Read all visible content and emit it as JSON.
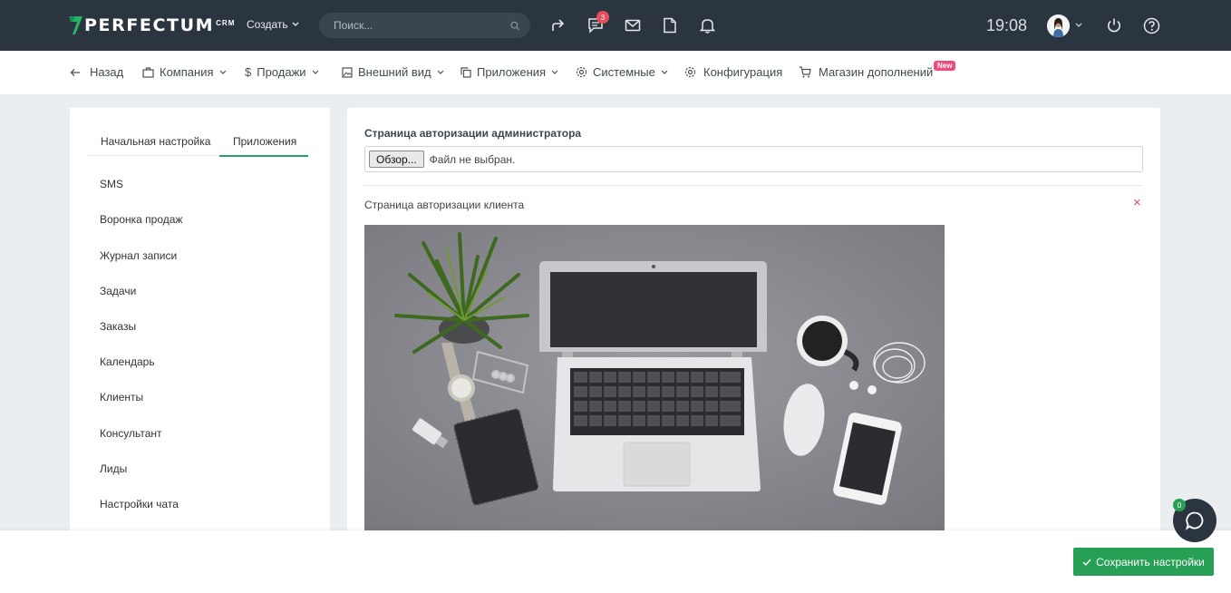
{
  "brand": {
    "name": "PERFECTUM",
    "suffix": "CRM"
  },
  "topbar": {
    "create_label": "Создать",
    "search_placeholder": "Поиск...",
    "messages_count": "3",
    "time": "19:08"
  },
  "menu": {
    "back": "Назад",
    "company": "Компания",
    "sales": "Продажи",
    "appearance": "Внешний вид",
    "apps": "Приложения",
    "system": "Системные",
    "config": "Конфигурация",
    "store": "Магазин дополнений",
    "new_badge": "New"
  },
  "left_panel": {
    "tabs": [
      {
        "label": "Начальная настройка"
      },
      {
        "label": "Приложения",
        "active": true
      }
    ],
    "items": [
      {
        "label": "SMS"
      },
      {
        "label": "Воронка продаж"
      },
      {
        "label": "Журнал записи"
      },
      {
        "label": "Задачи"
      },
      {
        "label": "Заказы"
      },
      {
        "label": "Календарь"
      },
      {
        "label": "Клиенты"
      },
      {
        "label": "Консультант"
      },
      {
        "label": "Лиды"
      },
      {
        "label": "Настройки чата"
      }
    ]
  },
  "main": {
    "admin_auth_label": "Страница авторизации администратора",
    "browse_button": "Обзор...",
    "file_status": "Файл не выбран.",
    "client_auth_label": "Страница авторизации клиента",
    "remove_symbol": "×"
  },
  "footer": {
    "save_label": "Сохранить настройки"
  },
  "chat": {
    "unread_count": "0"
  },
  "colors": {
    "topbar": "#2b3540",
    "accent": "#27a055",
    "badge": "#e74c5b",
    "new_badge": "#ef4b7b"
  }
}
